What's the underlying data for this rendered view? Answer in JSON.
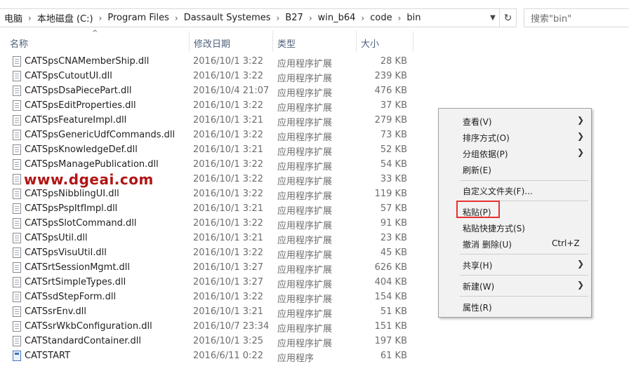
{
  "address_bar": {
    "crumbs": [
      "电脑",
      "本地磁盘 (C:)",
      "Program Files",
      "Dassault Systemes",
      "B27",
      "win_b64",
      "code",
      "bin"
    ],
    "separator": "›",
    "dropdown_icon": "chevron-down-icon",
    "refresh_icon": "refresh-icon"
  },
  "search": {
    "placeholder": "搜索\"bin\""
  },
  "columns": {
    "name": "名称",
    "date": "修改日期",
    "type": "类型",
    "size": "大小"
  },
  "files": [
    {
      "name": "CATSpsCNAMemberShip.dll",
      "date": "2016/10/1 3:22",
      "type": "应用程序扩展",
      "size": "28 KB",
      "icon": "dll"
    },
    {
      "name": "CATSpsCutoutUI.dll",
      "date": "2016/10/1 3:22",
      "type": "应用程序扩展",
      "size": "239 KB",
      "icon": "dll"
    },
    {
      "name": "CATSpsDsaPiecePart.dll",
      "date": "2016/10/4 21:07",
      "type": "应用程序扩展",
      "size": "476 KB",
      "icon": "dll"
    },
    {
      "name": "CATSpsEditProperties.dll",
      "date": "2016/10/1 3:22",
      "type": "应用程序扩展",
      "size": "37 KB",
      "icon": "dll"
    },
    {
      "name": "CATSpsFeatureImpl.dll",
      "date": "2016/10/1 3:21",
      "type": "应用程序扩展",
      "size": "279 KB",
      "icon": "dll"
    },
    {
      "name": "CATSpsGenericUdfCommands.dll",
      "date": "2016/10/1 3:22",
      "type": "应用程序扩展",
      "size": "73 KB",
      "icon": "dll"
    },
    {
      "name": "CATSpsKnowledgeDef.dll",
      "date": "2016/10/1 3:21",
      "type": "应用程序扩展",
      "size": "52 KB",
      "icon": "dll"
    },
    {
      "name": "CATSpsManagePublication.dll",
      "date": "2016/10/1 3:22",
      "type": "应用程序扩展",
      "size": "54 KB",
      "icon": "dll"
    },
    {
      "name": "",
      "date": "2016/10/1 3:22",
      "type": "应用程序扩展",
      "size": "33 KB",
      "icon": "dll"
    },
    {
      "name": "CATSpsNibblingUI.dll",
      "date": "2016/10/1 3:22",
      "type": "应用程序扩展",
      "size": "119 KB",
      "icon": "dll"
    },
    {
      "name": "CATSpsPspItfImpl.dll",
      "date": "2016/10/1 3:21",
      "type": "应用程序扩展",
      "size": "57 KB",
      "icon": "dll"
    },
    {
      "name": "CATSpsSlotCommand.dll",
      "date": "2016/10/1 3:22",
      "type": "应用程序扩展",
      "size": "91 KB",
      "icon": "dll"
    },
    {
      "name": "CATSpsUtil.dll",
      "date": "2016/10/1 3:21",
      "type": "应用程序扩展",
      "size": "23 KB",
      "icon": "dll"
    },
    {
      "name": "CATSpsVisuUtil.dll",
      "date": "2016/10/1 3:22",
      "type": "应用程序扩展",
      "size": "45 KB",
      "icon": "dll"
    },
    {
      "name": "CATSrtSessionMgmt.dll",
      "date": "2016/10/1 3:27",
      "type": "应用程序扩展",
      "size": "626 KB",
      "icon": "dll"
    },
    {
      "name": "CATSrtSimpleTypes.dll",
      "date": "2016/10/1 3:27",
      "type": "应用程序扩展",
      "size": "404 KB",
      "icon": "dll"
    },
    {
      "name": "CATSsdStepForm.dll",
      "date": "2016/10/1 3:22",
      "type": "应用程序扩展",
      "size": "154 KB",
      "icon": "dll"
    },
    {
      "name": "CATSsrEnv.dll",
      "date": "2016/10/1 3:21",
      "type": "应用程序扩展",
      "size": "51 KB",
      "icon": "dll"
    },
    {
      "name": "CATSsrWkbConfiguration.dll",
      "date": "2016/10/7 23:34",
      "type": "应用程序扩展",
      "size": "151 KB",
      "icon": "dll"
    },
    {
      "name": "CATStandardContainer.dll",
      "date": "2016/10/1 3:25",
      "type": "应用程序扩展",
      "size": "197 KB",
      "icon": "dll"
    },
    {
      "name": "CATSTART",
      "date": "2016/6/11 0:22",
      "type": "应用程序",
      "size": "61 KB",
      "icon": "exe"
    }
  ],
  "watermark": "www.dgeai.com",
  "context_menu": {
    "items": [
      {
        "label": "查看(V)",
        "submenu": true
      },
      {
        "label": "排序方式(O)",
        "submenu": true
      },
      {
        "label": "分组依据(P)",
        "submenu": true
      },
      {
        "label": "刷新(E)",
        "submenu": false
      },
      {
        "label": "自定义文件夹(F)...",
        "submenu": false
      },
      {
        "label": "粘贴(P)",
        "submenu": false,
        "highlighted": true
      },
      {
        "label": "粘贴快捷方式(S)",
        "submenu": false
      },
      {
        "label": "撤消 删除(U)",
        "shortcut": "Ctrl+Z",
        "submenu": false
      },
      {
        "label": "共享(H)",
        "submenu": true
      },
      {
        "label": "新建(W)",
        "submenu": true
      },
      {
        "label": "属性(R)",
        "submenu": false
      }
    ]
  },
  "colors": {
    "highlight_box": "#e83030",
    "watermark": "#b01515",
    "header_text": "#4c607a"
  }
}
